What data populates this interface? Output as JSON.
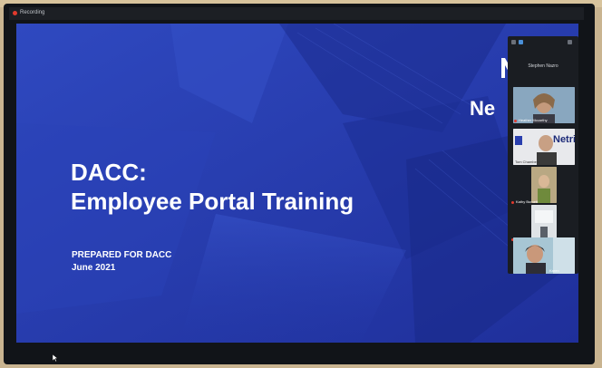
{
  "window": {
    "title": "Recording"
  },
  "slide": {
    "title_line1": "DACC:",
    "title_line2": "Employee Portal Training",
    "prepared_for": "PREPARED FOR DACC",
    "date": "June 2021",
    "brand_text": "Ne"
  },
  "participants_panel": {
    "host_name": "Stephen Nazro",
    "participants": [
      {
        "name": "Heather Mccarthy",
        "tile_color": "#7f9bb1"
      },
      {
        "name": "Tom Chambers",
        "partial_logo_text": "Netri",
        "tile_color": "#e8e9ec"
      },
      {
        "name": "Kathy Burnett",
        "tile_color": "#b8a06e"
      },
      {
        "name": "Julia",
        "tile_color": "#d9dde0"
      },
      {
        "name": "Karen",
        "tile_color": "#9fbfcf"
      }
    ]
  },
  "colors": {
    "slide_background": "#243bb0",
    "panel_background": "#1a1d22",
    "text": "#ffffff"
  }
}
